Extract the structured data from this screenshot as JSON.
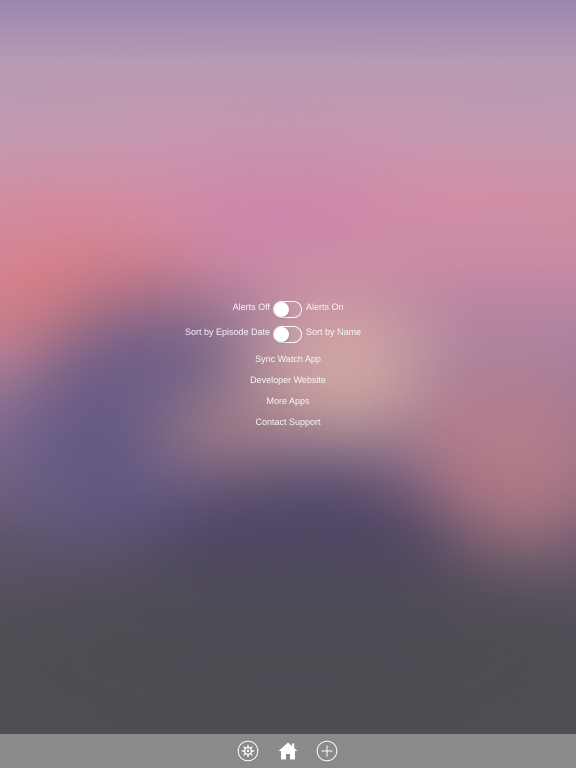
{
  "settings": {
    "alerts_toggle": {
      "off_label": "Alerts Off",
      "on_label": "Alerts On",
      "state": "off"
    },
    "sort_toggle": {
      "left_label": "Sort by Episode Date",
      "right_label": "Sort by Name",
      "state": "left"
    },
    "links": [
      "Sync Watch App",
      "Developer Website",
      "More Apps",
      "Contact Support"
    ]
  },
  "toolbar": {
    "items": [
      "gear-icon",
      "home-icon",
      "plus-icon"
    ]
  },
  "colors": {
    "toolbar_background": "#8a8a8a",
    "text": "#ffffff"
  }
}
